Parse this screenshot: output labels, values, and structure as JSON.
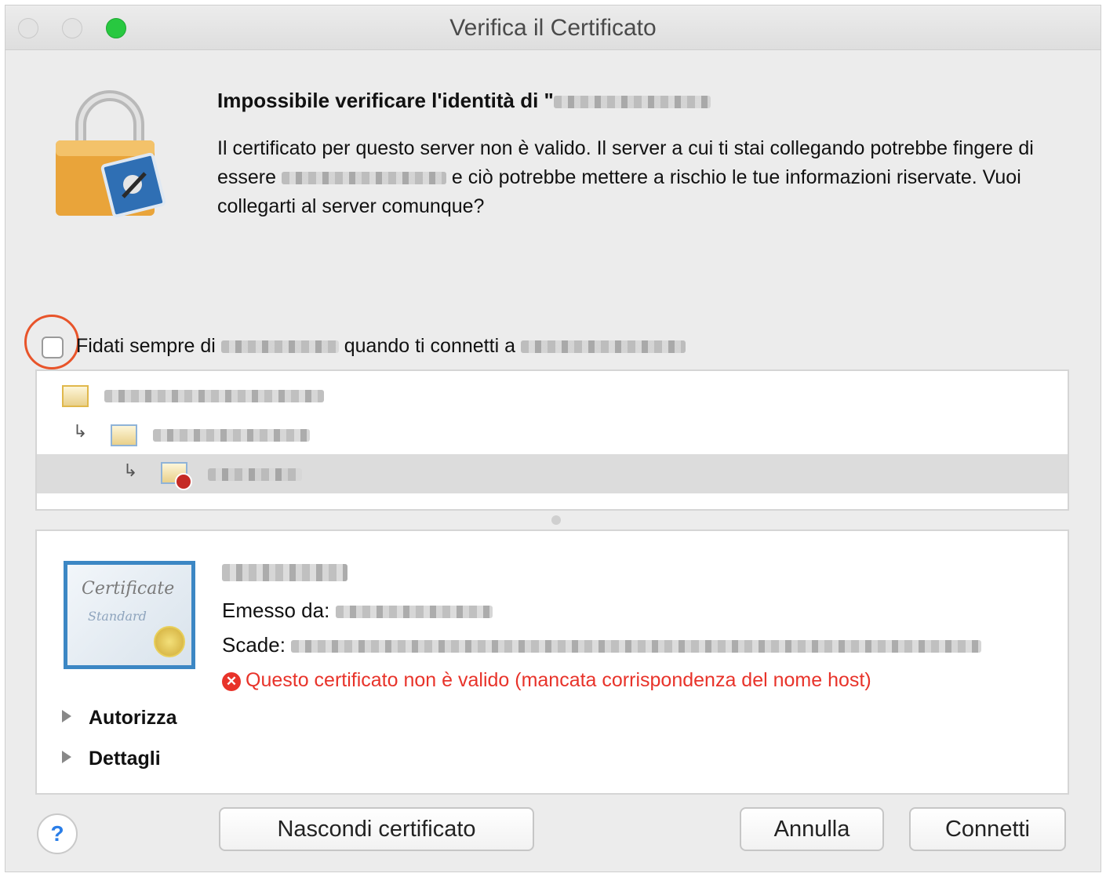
{
  "window": {
    "title": "Verifica il Certificato"
  },
  "dialog": {
    "heading": "Impossibile verificare l'identità di \"",
    "message_part1": "Il certificato per questo server non è valido. Il server a cui ti stai collegando potrebbe fingere di essere ",
    "message_part2": " e ciò potrebbe mettere a rischio le tue informazioni riservate. Vuoi collegarti al server comunque?"
  },
  "trust": {
    "label_part1": "Fidati sempre di ",
    "label_part2": " quando ti connetti a ",
    "checked": false,
    "highlight_color": "#e8542a"
  },
  "certificate": {
    "image_text1": "Certificate",
    "image_text2": "Standard",
    "issued_by_label": "Emesso da:",
    "expires_label": "Scade:",
    "error_text": "Questo certificato non è valido (mancata corrispondenza del nome host)",
    "error_color": "#e8332a",
    "sections": [
      "Autorizza",
      "Dettagli"
    ]
  },
  "buttons": {
    "help": "?",
    "hide_certificate": "Nascondi certificato",
    "cancel": "Annulla",
    "connect": "Connetti"
  }
}
